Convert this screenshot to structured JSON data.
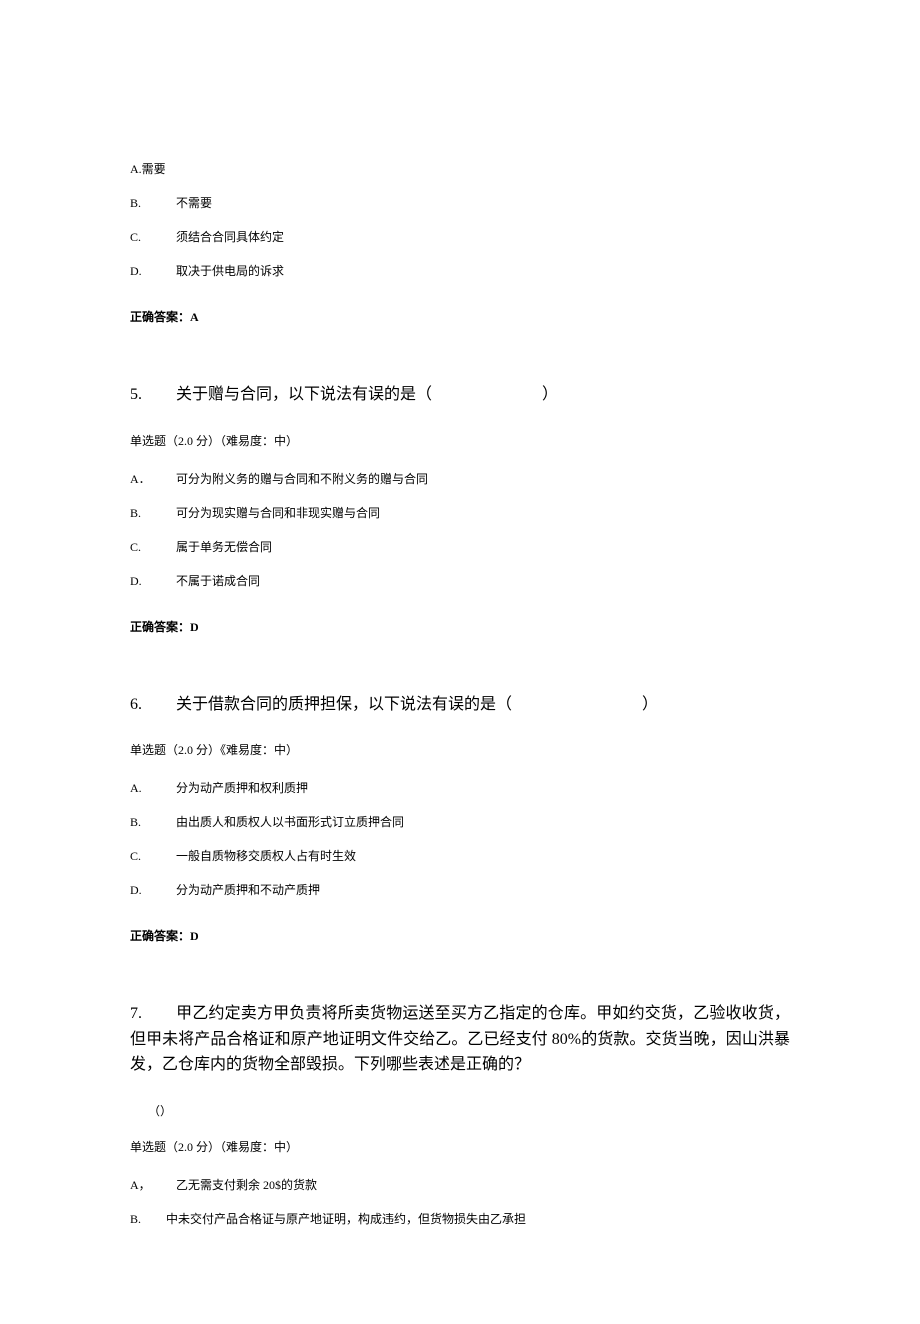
{
  "q4_tail": {
    "options": [
      {
        "letter": "A.",
        "text": "需要",
        "first": true
      },
      {
        "letter": "B.",
        "text": "不需要"
      },
      {
        "letter": "C.",
        "text": "须结合合同具体约定"
      },
      {
        "letter": "D.",
        "text": "取决于供电局的诉求"
      }
    ],
    "answer_label": "正确答案：",
    "answer_value": "A"
  },
  "q5": {
    "number": "5.",
    "title_before": "关于赠与合同，以下说法有误的是（",
    "title_after": "）",
    "meta": "单选题（2.0 分）（难易度：中）",
    "options": [
      {
        "letter": "A．",
        "text": "可分为附义务的赠与合同和不附义务的赠与合同"
      },
      {
        "letter": "B.",
        "text": "可分为现实赠与合同和非现实赠与合同"
      },
      {
        "letter": "C.",
        "text": "属于单务无偿合同"
      },
      {
        "letter": "D.",
        "text": "不属于诺成合同"
      }
    ],
    "answer_label": "正确答案：",
    "answer_value": "D"
  },
  "q6": {
    "number": "6.",
    "title_before": "关于借款合同的质押担保，以下说法有误的是（",
    "title_after": "）",
    "meta": "单选题（2.0 分）《难易度：中）",
    "options": [
      {
        "letter": "A.",
        "text": "分为动产质押和权利质押"
      },
      {
        "letter": "B.",
        "text": "由出质人和质权人以书面形式订立质押合同"
      },
      {
        "letter": "C.",
        "text": "一般自质物移交质权人占有时生效"
      },
      {
        "letter": "D.",
        "text": "分为动产质押和不动产质押"
      }
    ],
    "answer_label": "正确答案：",
    "answer_value": "D"
  },
  "q7": {
    "number": "7.",
    "title": "甲乙约定卖方甲负责将所卖货物运送至买方乙指定的仓库。甲如约交货，乙验收收货，但甲未将产品合格证和原产地证明文件交给乙。乙已经支付 80%的货款。交货当晚，因山洪暴发，乙仓库内的货物全部毁损。下列哪些表述是正确的？",
    "paren": "（）",
    "meta": "单选题（2.0 分）（难易度：中）",
    "options": [
      {
        "letter": "A，",
        "text": "乙无需支付剩余 20$的货款"
      },
      {
        "letter": "B.",
        "text": "中未交付产品合格证与原产地证明，构成违约，但货物损失由乙承担"
      }
    ]
  }
}
